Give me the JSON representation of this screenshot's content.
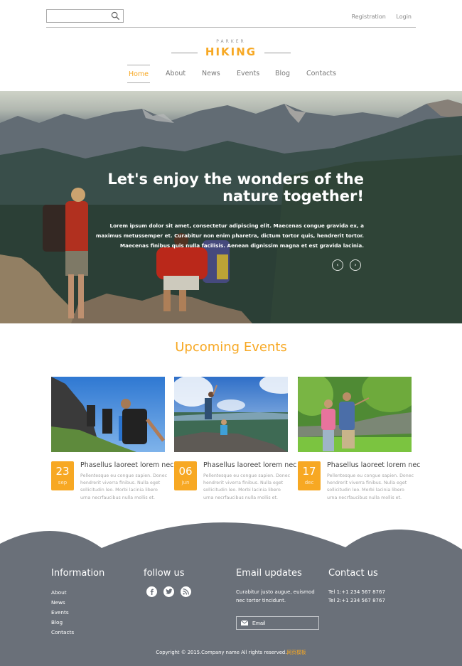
{
  "topbar": {
    "search": {
      "value": "",
      "placeholder": "",
      "icon": "search-icon"
    },
    "links": [
      "Registration",
      "Login"
    ]
  },
  "logo": {
    "small": "PARKER",
    "big": "HIKING"
  },
  "nav": {
    "items": [
      {
        "label": "Home",
        "active": true
      },
      {
        "label": "About",
        "active": false
      },
      {
        "label": "News",
        "active": false
      },
      {
        "label": "Events",
        "active": false
      },
      {
        "label": "Blog",
        "active": false
      },
      {
        "label": "Contacts",
        "active": false
      }
    ]
  },
  "hero": {
    "title_line1": "Let's enjoy the wonders of the",
    "title_line2": "nature together!",
    "text": "Lorem ipsum dolor sit amet, consectetur adipiscing elit. Maecenas congue gravida ex, a maximus metussemper et. Curabitur non enim pharetra, dictum tortor quis, hendrerit tortor. Maecenas finibus quis nulla facilisis. Aenean dignissim magna et est gravida lacinia.",
    "prev_icon": "‹",
    "next_icon": "›"
  },
  "events": {
    "title": "Upcoming Events",
    "items": [
      {
        "day": "23",
        "month": "sep",
        "title": "Phasellus laoreet lorem nec",
        "desc": "Pellentesque eu congue sapien. Donec hendrerit viverra finibus. Nulla eget sollicitudin leo. Morbi lacinia libero urna necrfaucibus nulla mollis et.",
        "image": "hikers-climbing-ridge"
      },
      {
        "day": "06",
        "month": "jun",
        "title": "Phasellus laoreet lorem nec",
        "desc": "Pellentesque eu congue sapien. Donec hendrerit viverra finibus. Nulla eget sollicitudin leo. Morbi lacinia libero urna necrfaucibus nulla mollis et.",
        "image": "hikers-on-summit-rock"
      },
      {
        "day": "17",
        "month": "dec",
        "title": "Phasellus laoreet lorem nec",
        "desc": "Pellentesque eu congue sapien. Donec hendrerit viverra finibus. Nulla eget sollicitudin leo. Morbi lacinia libero urna necrfaucibus nulla mollis et.",
        "image": "hikers-by-river"
      }
    ]
  },
  "footer": {
    "information": {
      "title": "Information",
      "links": [
        "About",
        "News",
        "Events",
        "Blog",
        "Contacts"
      ]
    },
    "follow": {
      "title": "follow us",
      "icons": [
        "facebook-icon",
        "twitter-icon",
        "rss-icon"
      ]
    },
    "email_updates": {
      "title": "Email updates",
      "text": "Curabitur justo augue, euismod nec tortor tincidunt.",
      "input_placeholder": "Email"
    },
    "contact": {
      "title": "Contact us",
      "lines": [
        "Tel 1:+1 234 567 8767",
        "Tel 2:+1 234 567 8767"
      ]
    },
    "copyright": "Copyright © 2015.Company name All rights reserved.",
    "copyright_link": "网页模板"
  },
  "colors": {
    "accent": "#f7a823",
    "footer_bg": "#6a7079",
    "text_muted": "#a5a5a5"
  }
}
